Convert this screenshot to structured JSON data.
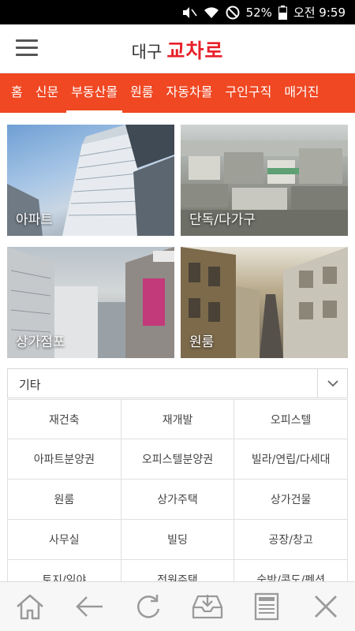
{
  "status": {
    "battery": "52%",
    "time": "오전 9:59"
  },
  "brand": {
    "prefix": "대구",
    "name": "교차로"
  },
  "tabs": [
    {
      "label": "홈"
    },
    {
      "label": "신문"
    },
    {
      "label": "부동산몰",
      "active": true
    },
    {
      "label": "원룸"
    },
    {
      "label": "자동차몰"
    },
    {
      "label": "구인구직"
    },
    {
      "label": "매거진"
    }
  ],
  "tiles": [
    {
      "label": "아파트"
    },
    {
      "label": "단독/다가구"
    },
    {
      "label": "상가점포"
    },
    {
      "label": "원룸"
    }
  ],
  "dropdown": {
    "value": "기타"
  },
  "grid": [
    [
      "재건축",
      "재개발",
      "오피스텔"
    ],
    [
      "아파트분양권",
      "오피스텔분양권",
      "빌라/연립/다세대"
    ],
    [
      "원룸",
      "상가주택",
      "상가건물"
    ],
    [
      "사무실",
      "빌딩",
      "공장/창고"
    ],
    [
      "토지/임야",
      "전원주택",
      "숙박/콘도/펜션"
    ]
  ],
  "colors": {
    "accent": "#f04823",
    "brand_red": "#e8202a"
  }
}
